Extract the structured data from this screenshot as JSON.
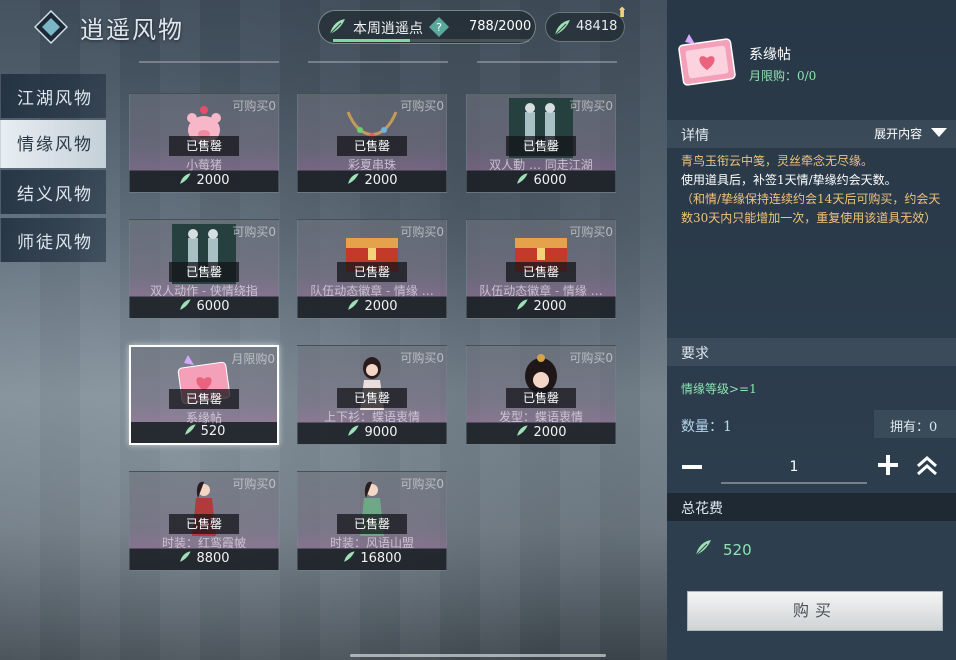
{
  "header": {
    "title": "逍遥风物",
    "weekly_label": "本周逍遥点",
    "weekly_value": "788/2000",
    "weekly_progress": 0.394,
    "currency_value": "48418"
  },
  "sidebar": {
    "items": [
      {
        "label": "江湖风物"
      },
      {
        "label": "情缘风物"
      },
      {
        "label": "结义风物"
      },
      {
        "label": "师徒风物"
      }
    ]
  },
  "items": [
    {
      "tag": "可购买0",
      "sold": "已售罄",
      "name": "小莓猪",
      "price": "2000",
      "thumb": "pig"
    },
    {
      "tag": "可购买0",
      "sold": "已售罄",
      "name": "彩夏串珠",
      "price": "2000",
      "thumb": "beads"
    },
    {
      "tag": "可购买0",
      "sold": "已售罄",
      "name": "双人動 … 同走江湖",
      "price": "6000",
      "thumb": "couple"
    },
    {
      "tag": "可购买0",
      "sold": "已售罄",
      "name": "双人动作 - 侠情绕指",
      "price": "6000",
      "thumb": "couple"
    },
    {
      "tag": "可购买0",
      "sold": "已售罄",
      "name": "队伍动态徽章 - 情缘 …",
      "price": "2000",
      "thumb": "chest"
    },
    {
      "tag": "可购买0",
      "sold": "已售罄",
      "name": "队伍动态徽章 - 情缘 …",
      "price": "2000",
      "thumb": "chest"
    },
    {
      "tag": "月限购0",
      "sold": "已售罄",
      "name": "系缘帖",
      "price": "520",
      "thumb": "card"
    },
    {
      "tag": "可购买0",
      "sold": "已售罄",
      "name": "上下衫：蝶语衷情",
      "price": "9000",
      "thumb": "girl"
    },
    {
      "tag": "可购买0",
      "sold": "已售罄",
      "name": "发型：蝶语衷情",
      "price": "2000",
      "thumb": "hair"
    },
    {
      "tag": "可购买0",
      "sold": "已售罄",
      "name": "时装：红鸾霞帔",
      "price": "8800",
      "thumb": "red"
    },
    {
      "tag": "可购买0",
      "sold": "已售罄",
      "name": "时装：风语山盟",
      "price": "16800",
      "thumb": "green"
    }
  ],
  "panel": {
    "item_title": "系缘帖",
    "limit": "月限购：0/0",
    "details_label": "详情",
    "expand_label": "展开内容",
    "desc_line1": "青鸟玉衔云中笺，灵丝牵念无尽缘。",
    "desc_line2": "使用道具后，补签1天情/挚缘约会天数。",
    "desc_line3": "（和情/挚缘保持连续约会14天后可购买，约会天数30天内只能增加一次，重复使用该道具无效）",
    "req_label": "要求",
    "req_text": "情缘等级>=1",
    "qty_label": "数量：1",
    "own_label": "拥有：0",
    "qty_value": "1",
    "total_label": "总花费",
    "total_value": "520",
    "buy_label": "购买"
  },
  "colors": {
    "accent_green": "#8ee3b0",
    "desc_gold": "#f0c37a",
    "panel_bg": "#283847"
  }
}
